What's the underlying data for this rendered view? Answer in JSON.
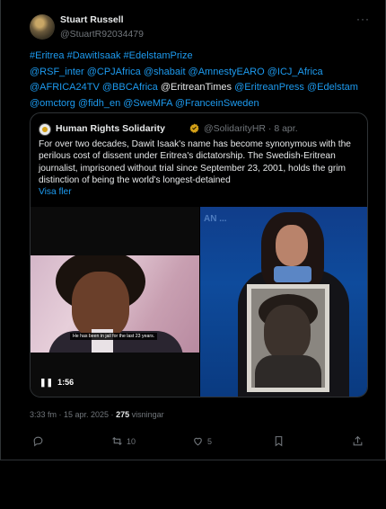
{
  "author": {
    "name": "Stuart Russell",
    "handle": "@StuartR92034479"
  },
  "tweet": {
    "text_segments": [
      {
        "text": "#Eritrea #DawitIsaak #EdelstamPrize",
        "link": true
      },
      {
        "text": "@RSF_inter @CPJAfrica @shabait @AmnestyEARO @ICJ_Africa @AFRICA24TV @BBCAfrica ",
        "link": true
      },
      {
        "text": "@EritreanTimes",
        "link": false
      },
      {
        "text": " @EritreanPress @Edelstam @omctorg @fidh_en @SweMFA @FranceinSweden",
        "link": true
      }
    ],
    "line1": "#Eritrea #DawitIsaak #EdelstamPrize",
    "line2a": "@RSF_inter @CPJAfrica @shabait @AmnestyEARO @ICJ_Africa",
    "line3a": "@AFRICA24TV @BBCAfrica ",
    "line3b": "@EritreanTimes",
    "line3c": " @EritreanPress @Edelstam",
    "line4": "@omctorg @fidh_en @SweMFA @FranceinSweden"
  },
  "quote": {
    "name": "Human Rights Solidarity",
    "handle_date": "@SolidarityHR · 8 apr.",
    "text": "For over two decades, Dawit Isaak's name has become synonymous with the perilous cost of dissent under Eritrea's dictatorship. The Swedish-Eritrean journalist, imprisoned without trial since September 23, 2001, holds the grim distinction of being the world's longest-detained",
    "show_more": "Visa fler",
    "video_caption": "He has been in jail for the last 23 years.",
    "video_duration": "1:56"
  },
  "meta": {
    "time_date": "3:33 fm · 15 apr. 2025 · ",
    "views_count": "275",
    "views_label": " visningar"
  },
  "actions": {
    "reply_count": "",
    "retweet_count": "10",
    "like_count": "5"
  }
}
